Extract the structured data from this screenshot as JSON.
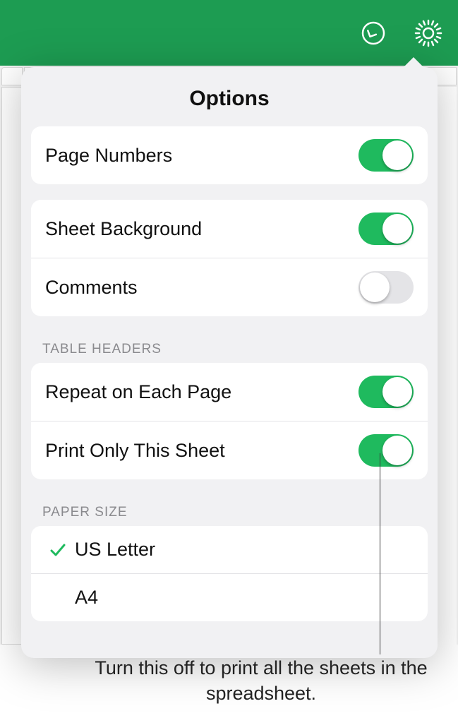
{
  "popover": {
    "title": "Options",
    "group1": [
      {
        "label": "Page Numbers",
        "on": true
      }
    ],
    "group2": [
      {
        "label": "Sheet Background",
        "on": true
      },
      {
        "label": "Comments",
        "on": false
      }
    ],
    "tableHeadersTitle": "TABLE HEADERS",
    "group3": [
      {
        "label": "Repeat on Each Page",
        "on": true
      },
      {
        "label": "Print Only This Sheet",
        "on": true
      }
    ],
    "paperTitle": "PAPER SIZE",
    "paperSizes": [
      {
        "label": "US Letter",
        "selected": true
      },
      {
        "label": "A4",
        "selected": false
      }
    ]
  },
  "callout": "Turn this off to print all the sheets in the spreadsheet."
}
